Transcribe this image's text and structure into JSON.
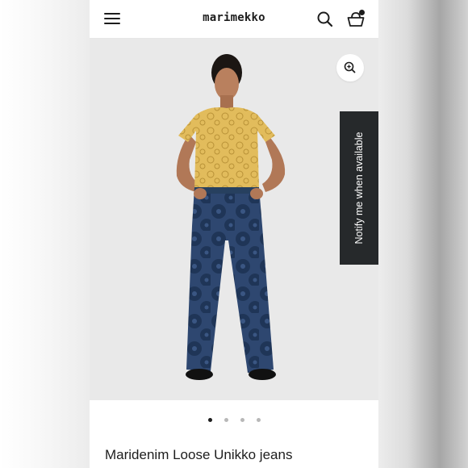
{
  "header": {
    "brand": "marimekko",
    "icons": {
      "menu": "hamburger-menu-icon",
      "search": "search-icon",
      "bag": "shopping-bag-icon"
    },
    "bag_badge": true
  },
  "gallery": {
    "zoom_icon": "zoom-in-icon",
    "notify_label": "Notify me when available",
    "slides": 4,
    "active_slide": 1
  },
  "product": {
    "title": "Maridenim Loose Unikko jeans"
  },
  "colors": {
    "dark": "#1d1d1d",
    "notify_bg": "#26292b",
    "tshirt": "#e2bc5c",
    "denim": "#2e4770",
    "background": "#e9e9e9"
  }
}
